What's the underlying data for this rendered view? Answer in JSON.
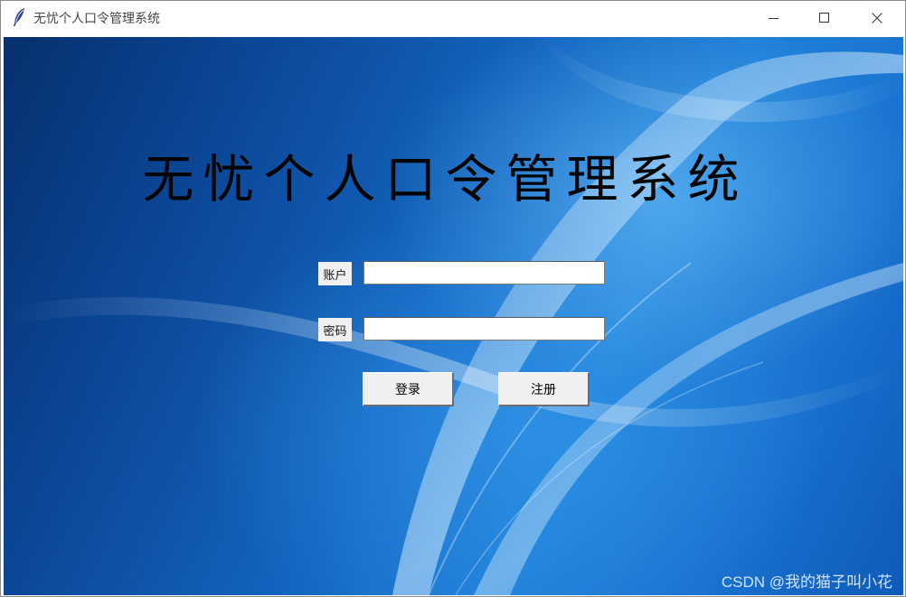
{
  "window": {
    "title": "无忧个人口令管理系统",
    "app_icon": "feather-icon",
    "controls": {
      "minimize_icon": "minimize-icon",
      "maximize_icon": "maximize-icon",
      "close_icon": "close-icon"
    }
  },
  "main": {
    "heading": "无忧个人口令管理系统",
    "account_label": "账户",
    "account_value": "",
    "password_label": "密码",
    "password_value": "",
    "login_button": "登录",
    "register_button": "注册"
  },
  "watermark": "CSDN @我的猫子叫小花",
  "colors": {
    "background_dark": "#07306e",
    "background_light": "#1e80d8",
    "label_bg": "#f0f0f0",
    "heading_text": "#050505"
  }
}
